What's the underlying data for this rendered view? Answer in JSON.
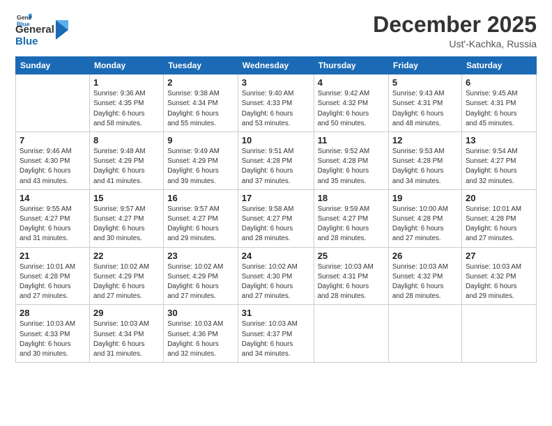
{
  "logo": {
    "line1": "General",
    "line2": "Blue"
  },
  "title": "December 2025",
  "location": "Ust'-Kachka, Russia",
  "days_header": [
    "Sunday",
    "Monday",
    "Tuesday",
    "Wednesday",
    "Thursday",
    "Friday",
    "Saturday"
  ],
  "weeks": [
    [
      {
        "day": "",
        "info": ""
      },
      {
        "day": "1",
        "info": "Sunrise: 9:36 AM\nSunset: 4:35 PM\nDaylight: 6 hours\nand 58 minutes."
      },
      {
        "day": "2",
        "info": "Sunrise: 9:38 AM\nSunset: 4:34 PM\nDaylight: 6 hours\nand 55 minutes."
      },
      {
        "day": "3",
        "info": "Sunrise: 9:40 AM\nSunset: 4:33 PM\nDaylight: 6 hours\nand 53 minutes."
      },
      {
        "day": "4",
        "info": "Sunrise: 9:42 AM\nSunset: 4:32 PM\nDaylight: 6 hours\nand 50 minutes."
      },
      {
        "day": "5",
        "info": "Sunrise: 9:43 AM\nSunset: 4:31 PM\nDaylight: 6 hours\nand 48 minutes."
      },
      {
        "day": "6",
        "info": "Sunrise: 9:45 AM\nSunset: 4:31 PM\nDaylight: 6 hours\nand 45 minutes."
      }
    ],
    [
      {
        "day": "7",
        "info": "Sunrise: 9:46 AM\nSunset: 4:30 PM\nDaylight: 6 hours\nand 43 minutes."
      },
      {
        "day": "8",
        "info": "Sunrise: 9:48 AM\nSunset: 4:29 PM\nDaylight: 6 hours\nand 41 minutes."
      },
      {
        "day": "9",
        "info": "Sunrise: 9:49 AM\nSunset: 4:29 PM\nDaylight: 6 hours\nand 39 minutes."
      },
      {
        "day": "10",
        "info": "Sunrise: 9:51 AM\nSunset: 4:28 PM\nDaylight: 6 hours\nand 37 minutes."
      },
      {
        "day": "11",
        "info": "Sunrise: 9:52 AM\nSunset: 4:28 PM\nDaylight: 6 hours\nand 35 minutes."
      },
      {
        "day": "12",
        "info": "Sunrise: 9:53 AM\nSunset: 4:28 PM\nDaylight: 6 hours\nand 34 minutes."
      },
      {
        "day": "13",
        "info": "Sunrise: 9:54 AM\nSunset: 4:27 PM\nDaylight: 6 hours\nand 32 minutes."
      }
    ],
    [
      {
        "day": "14",
        "info": "Sunrise: 9:55 AM\nSunset: 4:27 PM\nDaylight: 6 hours\nand 31 minutes."
      },
      {
        "day": "15",
        "info": "Sunrise: 9:57 AM\nSunset: 4:27 PM\nDaylight: 6 hours\nand 30 minutes."
      },
      {
        "day": "16",
        "info": "Sunrise: 9:57 AM\nSunset: 4:27 PM\nDaylight: 6 hours\nand 29 minutes."
      },
      {
        "day": "17",
        "info": "Sunrise: 9:58 AM\nSunset: 4:27 PM\nDaylight: 6 hours\nand 28 minutes."
      },
      {
        "day": "18",
        "info": "Sunrise: 9:59 AM\nSunset: 4:27 PM\nDaylight: 6 hours\nand 28 minutes."
      },
      {
        "day": "19",
        "info": "Sunrise: 10:00 AM\nSunset: 4:28 PM\nDaylight: 6 hours\nand 27 minutes."
      },
      {
        "day": "20",
        "info": "Sunrise: 10:01 AM\nSunset: 4:28 PM\nDaylight: 6 hours\nand 27 minutes."
      }
    ],
    [
      {
        "day": "21",
        "info": "Sunrise: 10:01 AM\nSunset: 4:28 PM\nDaylight: 6 hours\nand 27 minutes."
      },
      {
        "day": "22",
        "info": "Sunrise: 10:02 AM\nSunset: 4:29 PM\nDaylight: 6 hours\nand 27 minutes."
      },
      {
        "day": "23",
        "info": "Sunrise: 10:02 AM\nSunset: 4:29 PM\nDaylight: 6 hours\nand 27 minutes."
      },
      {
        "day": "24",
        "info": "Sunrise: 10:02 AM\nSunset: 4:30 PM\nDaylight: 6 hours\nand 27 minutes."
      },
      {
        "day": "25",
        "info": "Sunrise: 10:03 AM\nSunset: 4:31 PM\nDaylight: 6 hours\nand 28 minutes."
      },
      {
        "day": "26",
        "info": "Sunrise: 10:03 AM\nSunset: 4:32 PM\nDaylight: 6 hours\nand 28 minutes."
      },
      {
        "day": "27",
        "info": "Sunrise: 10:03 AM\nSunset: 4:32 PM\nDaylight: 6 hours\nand 29 minutes."
      }
    ],
    [
      {
        "day": "28",
        "info": "Sunrise: 10:03 AM\nSunset: 4:33 PM\nDaylight: 6 hours\nand 30 minutes."
      },
      {
        "day": "29",
        "info": "Sunrise: 10:03 AM\nSunset: 4:34 PM\nDaylight: 6 hours\nand 31 minutes."
      },
      {
        "day": "30",
        "info": "Sunrise: 10:03 AM\nSunset: 4:36 PM\nDaylight: 6 hours\nand 32 minutes."
      },
      {
        "day": "31",
        "info": "Sunrise: 10:03 AM\nSunset: 4:37 PM\nDaylight: 6 hours\nand 34 minutes."
      },
      {
        "day": "",
        "info": ""
      },
      {
        "day": "",
        "info": ""
      },
      {
        "day": "",
        "info": ""
      }
    ]
  ]
}
